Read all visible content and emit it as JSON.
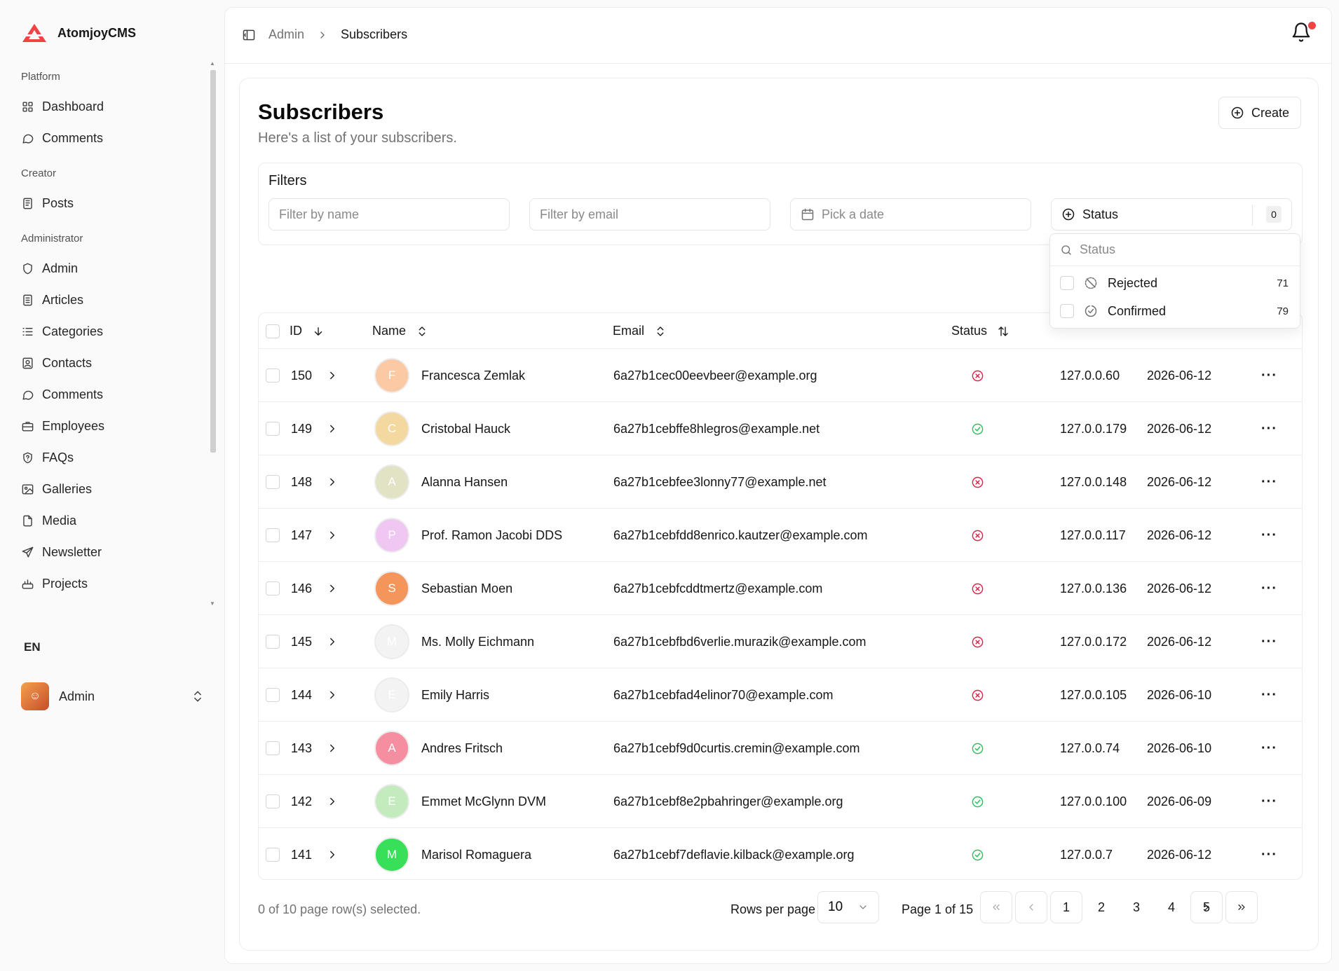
{
  "app": {
    "name": "AtomjoyCMS"
  },
  "sidebar": {
    "groups": [
      {
        "label": "Platform",
        "items": [
          {
            "label": "Dashboard",
            "icon": "dashboard-icon"
          },
          {
            "label": "Comments",
            "icon": "comment-icon"
          }
        ]
      },
      {
        "label": "Creator",
        "items": [
          {
            "label": "Posts",
            "icon": "posts-icon"
          }
        ]
      },
      {
        "label": "Administrator",
        "items": [
          {
            "label": "Admin",
            "icon": "shield-icon"
          },
          {
            "label": "Articles",
            "icon": "article-icon"
          },
          {
            "label": "Categories",
            "icon": "list-icon"
          },
          {
            "label": "Contacts",
            "icon": "contact-icon"
          },
          {
            "label": "Comments",
            "icon": "comment-icon"
          },
          {
            "label": "Employees",
            "icon": "briefcase-icon"
          },
          {
            "label": "FAQs",
            "icon": "faq-icon"
          },
          {
            "label": "Galleries",
            "icon": "gallery-icon"
          },
          {
            "label": "Media",
            "icon": "file-icon"
          },
          {
            "label": "Newsletter",
            "icon": "send-icon"
          },
          {
            "label": "Projects",
            "icon": "projects-icon"
          }
        ]
      }
    ],
    "language": "EN",
    "user": {
      "name": "Admin"
    }
  },
  "breadcrumb": {
    "parent": "Admin",
    "current": "Subscribers"
  },
  "page": {
    "title": "Subscribers",
    "subtitle": "Here's a list of your subscribers.",
    "create_label": "Create"
  },
  "filters": {
    "title": "Filters",
    "name_placeholder": "Filter by name",
    "email_placeholder": "Filter by email",
    "date_placeholder": "Pick a date",
    "status_label": "Status",
    "status_count": "0"
  },
  "status_dropdown": {
    "search_placeholder": "Status",
    "options": [
      {
        "label": "Rejected",
        "count": "71"
      },
      {
        "label": "Confirmed",
        "count": "79"
      }
    ]
  },
  "table": {
    "columns": {
      "id": "ID",
      "name": "Name",
      "email": "Email",
      "status": "Status"
    },
    "rows": [
      {
        "id": "150",
        "initial": "F",
        "avatar_color": "#fbc9a4",
        "name": "Francesca Zemlak",
        "email": "6a27b1cec00eevbeer@example.org",
        "status": "rejected",
        "ip": "127.0.0.60",
        "date": "2026-06-12"
      },
      {
        "id": "149",
        "initial": "C",
        "avatar_color": "#f3d9a0",
        "name": "Cristobal Hauck",
        "email": "6a27b1cebffe8hlegros@example.net",
        "status": "confirmed",
        "ip": "127.0.0.179",
        "date": "2026-06-12"
      },
      {
        "id": "148",
        "initial": "A",
        "avatar_color": "#e1e3c4",
        "name": "Alanna Hansen",
        "email": "6a27b1cebfee3lonny77@example.net",
        "status": "rejected",
        "ip": "127.0.0.148",
        "date": "2026-06-12"
      },
      {
        "id": "147",
        "initial": "P",
        "avatar_color": "#f0c6f2",
        "name": "Prof. Ramon Jacobi DDS",
        "email": "6a27b1cebfdd8enrico.kautzer@example.com",
        "status": "rejected",
        "ip": "127.0.0.117",
        "date": "2026-06-12"
      },
      {
        "id": "146",
        "initial": "S",
        "avatar_color": "#f4955c",
        "name": "Sebastian Moen",
        "email": "6a27b1cebfcddtmertz@example.com",
        "status": "rejected",
        "ip": "127.0.0.136",
        "date": "2026-06-12"
      },
      {
        "id": "145",
        "initial": "M",
        "avatar_color": "#f3f3f3",
        "name": "Ms. Molly Eichmann",
        "email": "6a27b1cebfbd6verlie.murazik@example.com",
        "status": "rejected",
        "ip": "127.0.0.172",
        "date": "2026-06-12"
      },
      {
        "id": "144",
        "initial": "E",
        "avatar_color": "#f3f3f3",
        "name": "Emily Harris",
        "email": "6a27b1cebfad4elinor70@example.com",
        "status": "rejected",
        "ip": "127.0.0.105",
        "date": "2026-06-10"
      },
      {
        "id": "143",
        "initial": "A",
        "avatar_color": "#f48ea0",
        "name": "Andres Fritsch",
        "email": "6a27b1cebf9d0curtis.cremin@example.com",
        "status": "confirmed",
        "ip": "127.0.0.74",
        "date": "2026-06-10"
      },
      {
        "id": "142",
        "initial": "E",
        "avatar_color": "#c4ebbd",
        "name": "Emmet McGlynn DVM",
        "email": "6a27b1cebf8e2pbahringer@example.org",
        "status": "confirmed",
        "ip": "127.0.0.100",
        "date": "2026-06-09"
      },
      {
        "id": "141",
        "initial": "M",
        "avatar_color": "#38e05a",
        "name": "Marisol Romaguera",
        "email": "6a27b1cebf7deflavie.kilback@example.org",
        "status": "confirmed",
        "ip": "127.0.0.7",
        "date": "2026-06-12"
      }
    ]
  },
  "footer": {
    "selection": "0 of 10 page row(s) selected.",
    "rows_per_page_label": "Rows per page",
    "rows_per_page": "10",
    "page_label": "Page 1 of 15",
    "pages": [
      "1",
      "2",
      "3",
      "4",
      "5"
    ]
  },
  "colors": {
    "brand": "#ef4444",
    "rejected": "#e11d48",
    "confirmed": "#22c55e"
  }
}
